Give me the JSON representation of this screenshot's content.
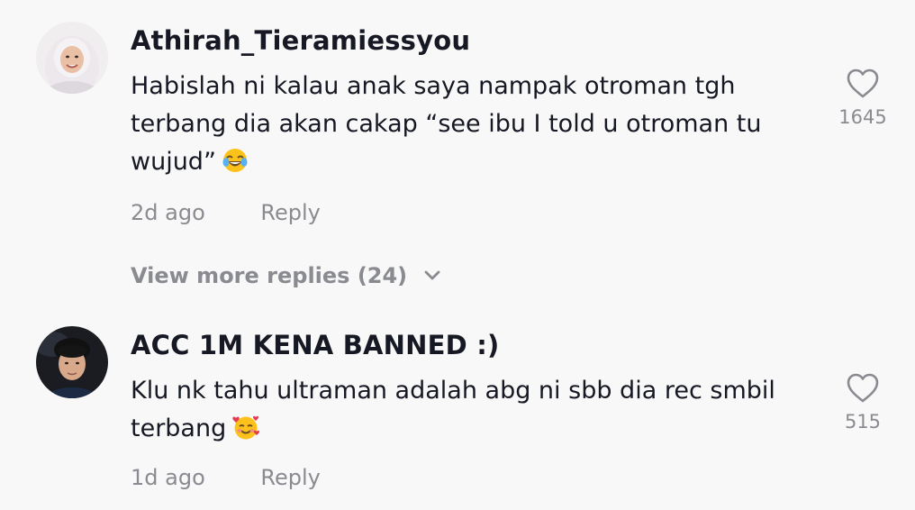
{
  "comments": [
    {
      "username": "Athirah_Tieramiessyou",
      "text_lines": [
        "Habislah ni kalau anak saya nampak otroman tgh",
        "terbang dia akan cakap “see ibu I told u otroman tu",
        "wujud”"
      ],
      "emoji": "face-with-tears-of-joy",
      "time": "2d ago",
      "reply_label": "Reply",
      "likes": "1645"
    },
    {
      "username": "ACC 1M KENA BANNED :)",
      "text_lines": [
        "Klu nk tahu ultraman adalah abg ni sbb dia rec smbil",
        "terbang"
      ],
      "emoji": "smiling-face-with-hearts",
      "time": "1d ago",
      "reply_label": "Reply",
      "likes": "515"
    }
  ],
  "view_more_replies": "View more replies (24)",
  "icons": {
    "like": "heart-outline-icon",
    "expand": "chevron-down-icon"
  },
  "colors": {
    "background": "#f8f8f8",
    "primary_text": "#161823",
    "secondary_text": "#8a8b91"
  }
}
